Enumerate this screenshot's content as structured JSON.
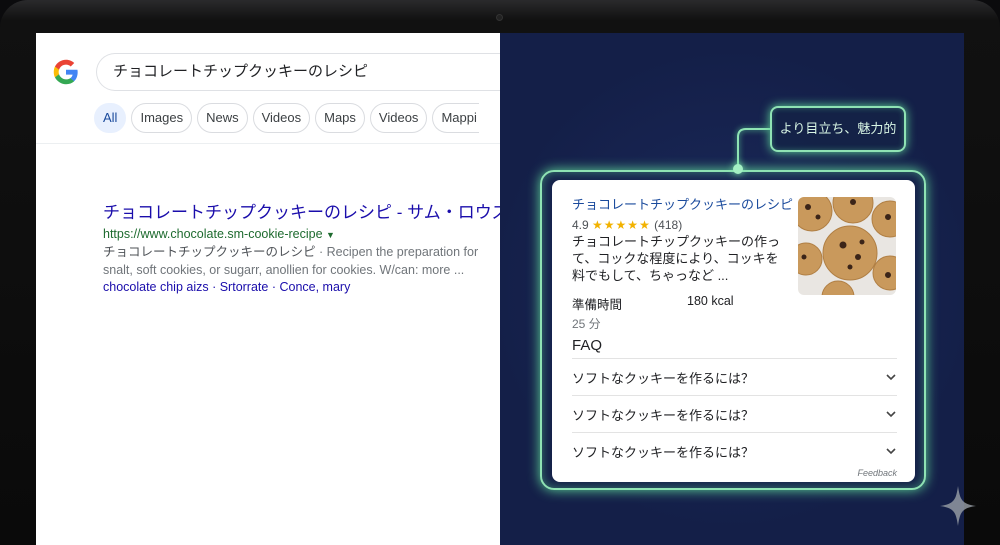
{
  "search": {
    "query": "チョコレートチップクッキーのレシピ",
    "tabs": [
      {
        "label": "All",
        "active": true
      },
      {
        "label": "Images"
      },
      {
        "label": "News"
      },
      {
        "label": "Videos"
      },
      {
        "label": "Maps"
      },
      {
        "label": "Videos"
      },
      {
        "label": "Mappi"
      }
    ]
  },
  "result": {
    "title": "チョコレートチップクッキーのレシピ - サム・ロウズ",
    "url": "https://www.chocolate.sm-cookie-recipe",
    "snippet_bold": "チョコレートチップクッキーのレシピ",
    "snippet": " · Recipen the preparation for snalt, soft cookies, or sugarr, anollien for cookies. W/can: more ...",
    "links": "chocolate chip aizs · Srtorrate · Conce, mary"
  },
  "callout": {
    "label": "より目立ち、魅力的"
  },
  "rich": {
    "title": "チョコレートチップクッキーのレシピ",
    "rating": "4.9",
    "stars": "★★★★★",
    "reviews": "(418)",
    "description": "チョコレートチップクッキーの作って、コックな程度により、コッキを料でもして、ちゃっなど ...",
    "prep_label": "準備時間",
    "prep_value": "25 分",
    "calories": "180 kcal",
    "faq_title": "FAQ",
    "faq": [
      "ソフトなクッキーを作るには？",
      "ソフトなクッキーを作るには？",
      "ソフトなクッキーを作るには？"
    ],
    "feedback": "Feedback"
  },
  "colors": {
    "glow": "#8fe3b4",
    "background": "#141f48",
    "link": "#1a0dab"
  }
}
